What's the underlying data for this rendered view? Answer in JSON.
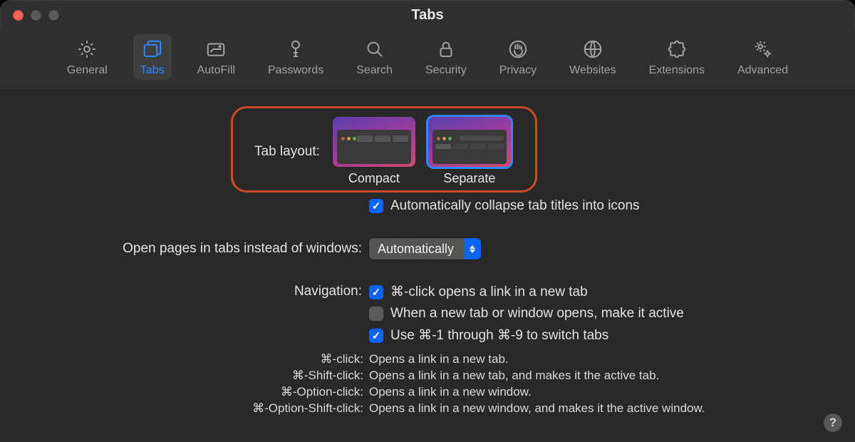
{
  "window": {
    "title": "Tabs"
  },
  "toolbar": {
    "items": [
      {
        "label": "General"
      },
      {
        "label": "Tabs"
      },
      {
        "label": "AutoFill"
      },
      {
        "label": "Passwords"
      },
      {
        "label": "Search"
      },
      {
        "label": "Security"
      },
      {
        "label": "Privacy"
      },
      {
        "label": "Websites"
      },
      {
        "label": "Extensions"
      },
      {
        "label": "Advanced"
      }
    ],
    "selected_index": 1
  },
  "tab_layout": {
    "label": "Tab layout:",
    "options": [
      {
        "label": "Compact"
      },
      {
        "label": "Separate"
      }
    ],
    "selected_index": 1
  },
  "collapse_titles": {
    "label": "Automatically collapse tab titles into icons",
    "checked": true
  },
  "open_pages": {
    "label": "Open pages in tabs instead of windows:",
    "value": "Automatically"
  },
  "navigation": {
    "label": "Navigation:",
    "options": [
      {
        "label": "⌘-click opens a link in a new tab",
        "checked": true
      },
      {
        "label": "When a new tab or window opens, make it active",
        "checked": false
      },
      {
        "label": "Use ⌘-1 through ⌘-9 to switch tabs",
        "checked": true
      }
    ]
  },
  "notes": [
    {
      "key": "⌘-click:",
      "value": "Opens a link in a new tab."
    },
    {
      "key": "⌘-Shift-click:",
      "value": "Opens a link in a new tab, and makes it the active tab."
    },
    {
      "key": "⌘-Option-click:",
      "value": "Opens a link in a new window."
    },
    {
      "key": "⌘-Option-Shift-click:",
      "value": "Opens a link in a new window, and makes it the active window."
    }
  ],
  "help": {
    "label": "?"
  }
}
